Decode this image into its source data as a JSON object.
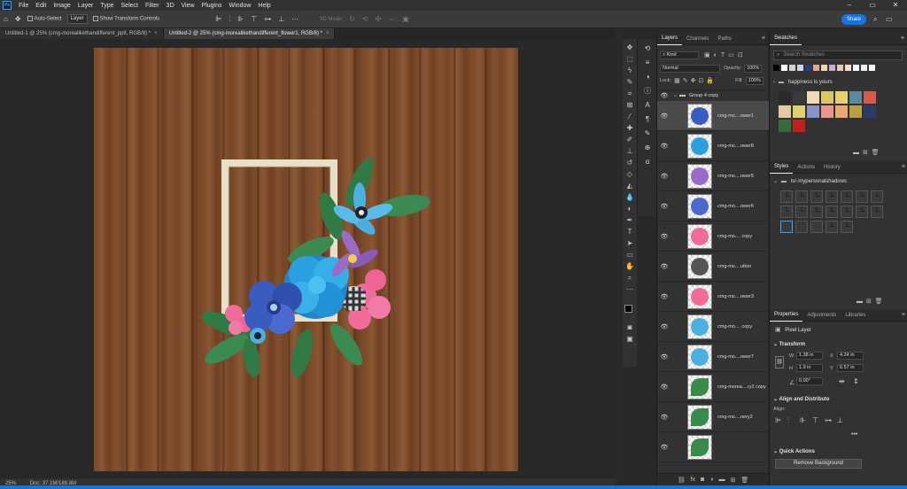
{
  "app": {
    "menu": [
      "File",
      "Edit",
      "Image",
      "Layer",
      "Type",
      "Select",
      "Filter",
      "3D",
      "View",
      "Plugins",
      "Window",
      "Help"
    ],
    "ps_icon_text": "Ps"
  },
  "options_bar": {
    "auto_select_label": "Auto-Select",
    "auto_select_target": "Layer",
    "show_transform_label": "Show Transform Controls",
    "mode_3d_label": "3D Mode:",
    "share_label": "Share"
  },
  "tabs": [
    {
      "label": "Untitled-1 @ 25% (cmg-morealikethandifferent_pp8, RGB/8) *",
      "active": false
    },
    {
      "label": "Untitled-2 @ 25% (cmg-morealikethandifferent_flower1, RGB/8) *",
      "active": true
    }
  ],
  "status": {
    "zoom": "25%",
    "doc": "Doc: 37.1M/188.8M"
  },
  "layers_panel": {
    "tabs": [
      "Layers",
      "Channels",
      "Paths"
    ],
    "filter_kind": "Kind",
    "blend_mode": "Normal",
    "opacity_label": "Opacity:",
    "opacity": "100%",
    "lock_label": "Lock:",
    "fill_label": "Fill:",
    "fill": "100%",
    "group_name": "Group 4 copy",
    "layers": [
      {
        "name": "cmg-mo....ower1",
        "color": "#3a5cc0"
      },
      {
        "name": "cmg-mo....ower8",
        "color": "#2aa0e0"
      },
      {
        "name": "cmg-mo....ower5",
        "color": "#9a6ac8"
      },
      {
        "name": "cmg-mo....ower6",
        "color": "#4a6ad0"
      },
      {
        "name": "cmg-mo.... copy",
        "color": "#f06a9a"
      },
      {
        "name": "cmg-mo....utton",
        "color": "#555555"
      },
      {
        "name": "cmg-mo....ower3",
        "color": "#f06a9a"
      },
      {
        "name": "cmg-mo.... copy",
        "color": "#4ab0e0"
      },
      {
        "name": "cmg-mo....ower7",
        "color": "#4ab0e0"
      },
      {
        "name": "cmg-morea....ry2 copy",
        "color": "#3a8a4a"
      },
      {
        "name": "cmg-mo....nery2",
        "color": "#3a8a4a"
      },
      {
        "name": "",
        "color": "#3a8a4a"
      }
    ]
  },
  "swatches": {
    "title": "Swatches",
    "search_placeholder": "Search Swatches",
    "recent": [
      "#000000",
      "#ffffff",
      "#d8d2c8",
      "#c8d8e0",
      "#2a3a7a",
      "#e0a890",
      "#f0d8b0",
      "#c8b0c8",
      "#e8c8b8",
      "#f8e0c8",
      "#ffffff",
      "#f0f0f0",
      "#ffffff"
    ],
    "group_name": "happiness is yours",
    "group_colors": [
      "#2a2a2a",
      "#3a3a3a",
      "#f0d8b0",
      "#d8c860",
      "#e8d070",
      "#5a8aa0",
      "#d85a4a",
      "#e8c8a0",
      "#e0d070",
      "#8a90c8",
      "#e89888",
      "#e8a870",
      "#b8a040",
      "#2a3a6a",
      "#3a6a3a",
      "#c02020"
    ]
  },
  "styles": {
    "tabs": [
      "Styles",
      "Actions",
      "History"
    ],
    "group_name": "lsr-mypersonalshadows"
  },
  "properties": {
    "tabs": [
      "Properties",
      "Adjustments",
      "Libraries"
    ],
    "kind": "Pixel Layer",
    "transform_label": "Transform",
    "w_label": "W",
    "w": "1.38 in",
    "h_label": "H",
    "h": "1.9 in",
    "x_label": "X",
    "x": "4.24 in",
    "y_label": "Y",
    "y": "6.57 in",
    "angle": "0.00°",
    "align_label": "Align and Distribute",
    "align_sub": "Align:",
    "more": "•••",
    "quick_actions_label": "Quick Actions",
    "remove_bg_label": "Remove Background"
  }
}
